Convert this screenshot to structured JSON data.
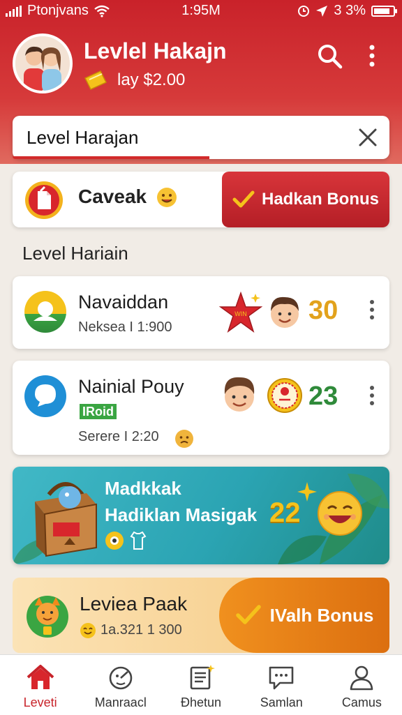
{
  "status_bar": {
    "carrier": "Ptonjvans",
    "time": "1:95M",
    "battery": "3 3%"
  },
  "header": {
    "title": "Levlel Hakajn",
    "balance": "lay $2.00"
  },
  "search": {
    "value": "Level Harajan"
  },
  "caveat_card": {
    "title": "Caveak",
    "button_label": "Hadkan Bonus"
  },
  "section_title": "Level Hariain",
  "list_items": [
    {
      "title": "Navaiddan",
      "subtitle": "Neksea I 1:900",
      "score": "30",
      "score_color": "#e2a21c",
      "badge": ""
    },
    {
      "title": "Nainial Pouy",
      "subtitle": "Serere I 2:20",
      "score": "23",
      "score_color": "#2f8a3a",
      "badge": "IRoid"
    }
  ],
  "promo": {
    "line1": "Madkkak",
    "line2": "Hadiklan Masigak",
    "number": "22"
  },
  "pack": {
    "title": "Leviea Paak",
    "subtitle": "1a.321 1 300",
    "button_label": "IValh Bonus"
  },
  "nav": [
    {
      "label": "Leveti",
      "icon": "home-icon",
      "active": true
    },
    {
      "label": "Manraacl",
      "icon": "clock-face-icon",
      "active": false
    },
    {
      "label": "Đhetun",
      "icon": "notes-icon",
      "active": false
    },
    {
      "label": "Samlan",
      "icon": "chat-icon",
      "active": false
    },
    {
      "label": "Camus",
      "icon": "profile-icon",
      "active": false
    }
  ],
  "colors": {
    "brand_red": "#c9222a",
    "accent_orange": "#e07a12",
    "promo_teal": "#2ba4b3"
  }
}
